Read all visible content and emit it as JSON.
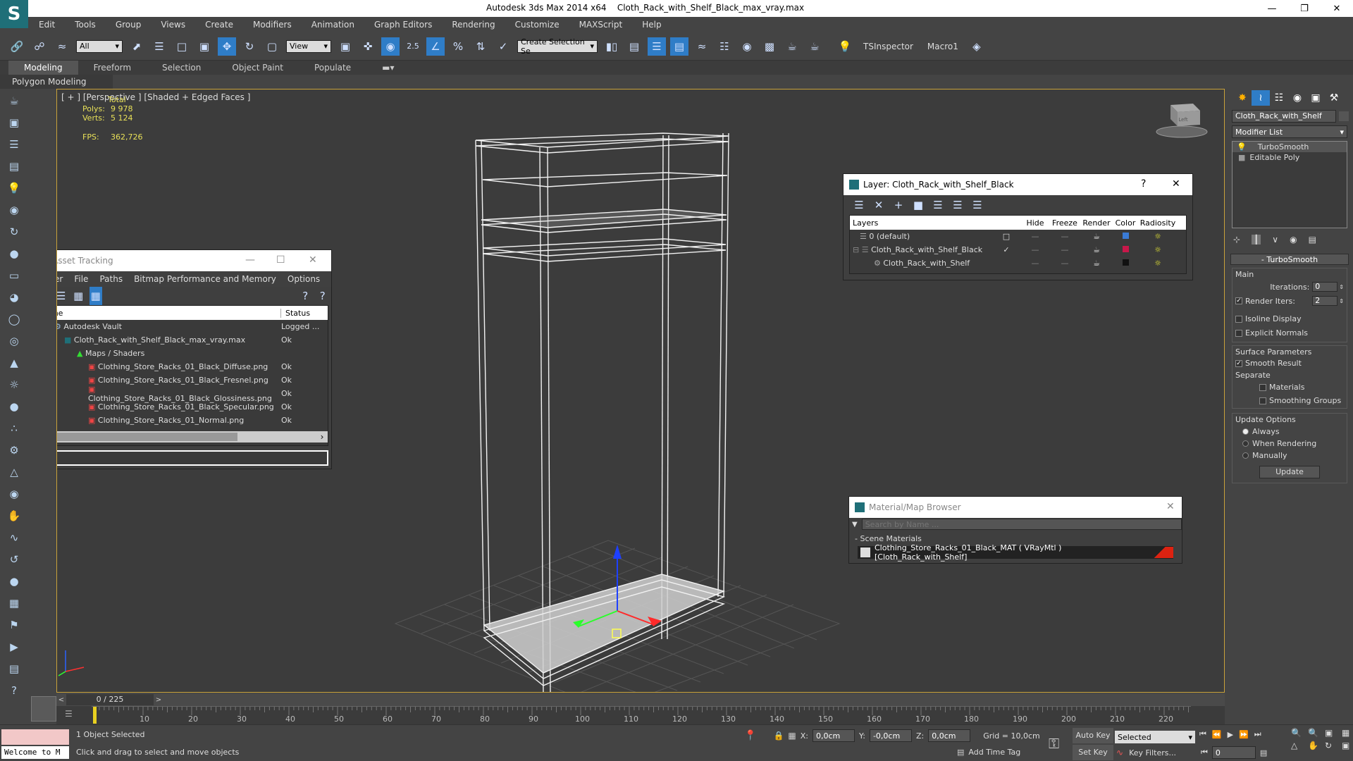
{
  "window": {
    "app_name": "Autodesk 3ds Max  2014 x64",
    "file_name": "Cloth_Rack_with_Shelf_Black_max_vray.max"
  },
  "menu": [
    "Edit",
    "Tools",
    "Group",
    "Views",
    "Create",
    "Modifiers",
    "Animation",
    "Graph Editors",
    "Rendering",
    "Customize",
    "MAXScript",
    "Help"
  ],
  "toolbar": {
    "filter_select": "All",
    "view_select": "View",
    "snap_value": "2.5",
    "selection_set": "Create Selection Se",
    "tsinspector_label": "TSInspector",
    "macro_label": "Macro1"
  },
  "ribbon": {
    "tabs": [
      "Modeling",
      "Freeform",
      "Selection",
      "Object Paint",
      "Populate"
    ],
    "active_tab": "Modeling",
    "sub_label": "Polygon Modeling"
  },
  "viewport": {
    "label": "[ + ] [Perspective ] [Shaded + Edged Faces ]",
    "stats": {
      "total_label": "Total",
      "polys_label": "Polys:",
      "polys_value": "9 978",
      "verts_label": "Verts:",
      "verts_value": "5 124",
      "fps_label": "FPS:",
      "fps_value": "362,726"
    },
    "viewcube_label": "Left"
  },
  "asset_tracking": {
    "title": "Asset Tracking",
    "menu": [
      "Server",
      "File",
      "Paths",
      "Bitmap Performance and Memory",
      "Options"
    ],
    "columns": {
      "name": "Name",
      "status": "Status"
    },
    "rows": [
      {
        "name": "Autodesk Vault",
        "status": "Logged ...",
        "indent": 0
      },
      {
        "name": "Cloth_Rack_with_Shelf_Black_max_vray.max",
        "status": "Ok",
        "indent": 1
      },
      {
        "name": "Maps / Shaders",
        "status": "",
        "indent": 2
      },
      {
        "name": "Clothing_Store_Racks_01_Black_Diffuse.png",
        "status": "Ok",
        "indent": 3
      },
      {
        "name": "Clothing_Store_Racks_01_Black_Fresnel.png",
        "status": "Ok",
        "indent": 3
      },
      {
        "name": "Clothing_Store_Racks_01_Black_Glossiness.png",
        "status": "Ok",
        "indent": 3
      },
      {
        "name": "Clothing_Store_Racks_01_Black_Specular.png",
        "status": "Ok",
        "indent": 3
      },
      {
        "name": "Clothing_Store_Racks_01_Normal.png",
        "status": "Ok",
        "indent": 3
      }
    ]
  },
  "layer_window": {
    "title": "Layer: Cloth_Rack_with_Shelf_Black",
    "help": "?",
    "columns": {
      "layers": "Layers",
      "hide": "Hide",
      "freeze": "Freeze",
      "render": "Render",
      "color": "Color",
      "radiosity": "Radiosity"
    },
    "rows": [
      {
        "name": "0 (default)",
        "color": "#3a7bd5",
        "indent": 1
      },
      {
        "name": "Cloth_Rack_with_Shelf_Black",
        "color": "#c8184a",
        "indent": 1
      },
      {
        "name": "Cloth_Rack_with_Shelf",
        "color": "#111111",
        "indent": 2
      }
    ]
  },
  "material_browser": {
    "title": "Material/Map Browser",
    "search_placeholder": "Search by Name ...",
    "section_label": "- Scene Materials",
    "material_item": "Clothing_Store_Racks_01_Black_MAT ( VRayMtl ) [Cloth_Rack_with_Shelf]"
  },
  "command_panel": {
    "object_name": "Cloth_Rack_with_Shelf",
    "modifier_list": "Modifier List",
    "stack": [
      "TurboSmooth",
      "Editable Poly"
    ],
    "turbosmooth": {
      "title": "TurboSmooth",
      "main_label": "Main",
      "iterations_label": "Iterations:",
      "iterations_value": "0",
      "render_iters_label": "Render Iters:",
      "render_iters_value": "2",
      "isoline_label": "Isoline Display",
      "explicit_normals_label": "Explicit Normals",
      "surface_params_label": "Surface Parameters",
      "smooth_result_label": "Smooth Result",
      "separate_label": "Separate",
      "materials_label": "Materials",
      "smoothing_groups_label": "Smoothing Groups",
      "update_options_label": "Update Options",
      "always_label": "Always",
      "when_rendering_label": "When Rendering",
      "manually_label": "Manually",
      "update_button": "Update"
    }
  },
  "timeline": {
    "frame_display": "0 / 225",
    "ticks": [
      "10",
      "20",
      "30",
      "40",
      "50",
      "60",
      "70",
      "80",
      "90",
      "100",
      "110",
      "120",
      "130",
      "140",
      "150",
      "160",
      "170",
      "180",
      "190",
      "200",
      "210",
      "220"
    ]
  },
  "status": {
    "maxscript_listener": "Welcome to M",
    "selection_info": "1 Object Selected",
    "prompt": "Click and drag to select and move objects",
    "x_label": "X:",
    "x_value": "0,0cm",
    "y_label": "Y:",
    "y_value": "-0,0cm",
    "z_label": "Z:",
    "z_value": "0,0cm",
    "grid": "Grid = 10,0cm",
    "add_time_tag": "Add Time Tag",
    "auto_key": "Auto Key",
    "set_key": "Set Key",
    "selected_dropdown": "Selected",
    "key_filters": "Key Filters...",
    "frame_value": "0"
  }
}
